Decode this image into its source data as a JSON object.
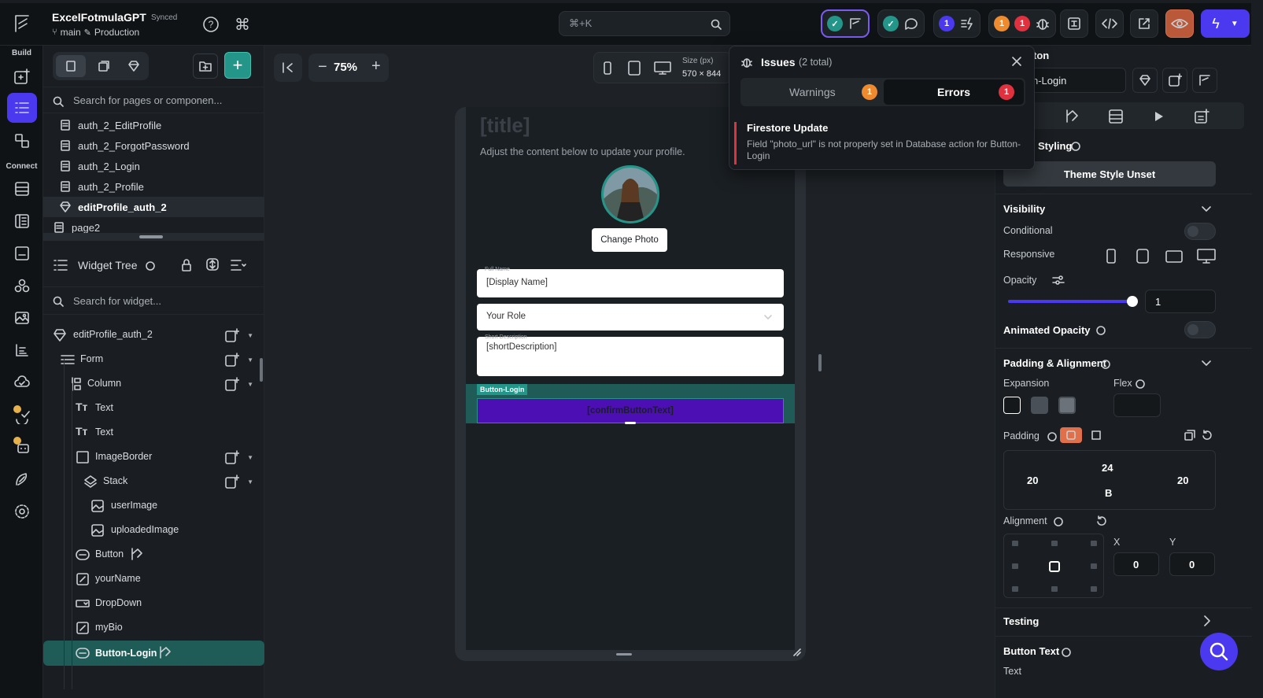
{
  "app": {
    "project": "ExcelFotmulaGPT",
    "sync_status": "Synced",
    "branch": "main",
    "environment": "Production"
  },
  "topbar": {
    "search_shortcut": "⌘+K",
    "badges": {
      "ai_count": "1",
      "warn_count": "1",
      "error_count": "1"
    }
  },
  "rail": {
    "build_label": "Build",
    "connect_label": "Connect"
  },
  "pages": {
    "search_placeholder": "Search for pages or componen...",
    "items": [
      "auth_2_EditProfile",
      "auth_2_ForgotPassword",
      "auth_2_Login",
      "auth_2_Profile",
      "editProfile_auth_2",
      "page2"
    ]
  },
  "widget_tree": {
    "title": "Widget Tree",
    "search_placeholder": "Search for widget...",
    "rows": [
      "editProfile_auth_2",
      "Form",
      "Column",
      "Text",
      "Text",
      "ImageBorder",
      "Stack",
      "userImage",
      "uploadedImage",
      "Button",
      "yourName",
      "DropDown",
      "myBio",
      "Button-Login"
    ]
  },
  "canvas": {
    "zoom": "75%",
    "size_label": "Size (px)",
    "size_value": "570 × 844",
    "screen": {
      "title": "[title]",
      "subtitle": "Adjust the content below to update your profile.",
      "change_photo": "Change Photo",
      "full_name_label": "Full Name",
      "display_name": "[Display Name]",
      "role_placeholder": "Your Role",
      "short_desc_label": "Short Description",
      "short_desc_value": "[shortDescription]",
      "selected_tag": "Button-Login",
      "confirm_button": "[confirmButtonText]"
    }
  },
  "issues": {
    "title": "Issues",
    "total": "(2 total)",
    "tabs": {
      "warnings": "Warnings",
      "warnings_count": "1",
      "errors": "Errors",
      "errors_count": "1"
    },
    "item_title": "Firestore Update",
    "item_desc": "Field \"photo_url\" is not properly set in Database action for Button-Login"
  },
  "right": {
    "header_partial": "ton",
    "name_value": "n-Login",
    "styling_label": "Styling",
    "theme_style": "Theme Style Unset",
    "visibility": "Visibility",
    "conditional": "Conditional",
    "responsive": "Responsive",
    "opacity": "Opacity",
    "opacity_value": "1",
    "opacity_fraction": 1,
    "animated_opacity": "Animated Opacity",
    "padding_alignment": "Padding & Alignment",
    "expansion": "Expansion",
    "flex": "Flex",
    "padding": "Padding",
    "pad_top": "24",
    "pad_left": "20",
    "pad_right": "20",
    "pad_bottom": "B",
    "alignment": "Alignment",
    "align_x_label": "X",
    "align_y_label": "Y",
    "align_x": "0",
    "align_y": "0",
    "testing": "Testing",
    "button_text": "Button Text",
    "text_label": "Text"
  },
  "colors": {
    "accent": "#4b39ef",
    "teal": "#249689",
    "error": "#e0313f",
    "warning": "#ee8b2e",
    "button_fill": "#4b0fb4"
  }
}
